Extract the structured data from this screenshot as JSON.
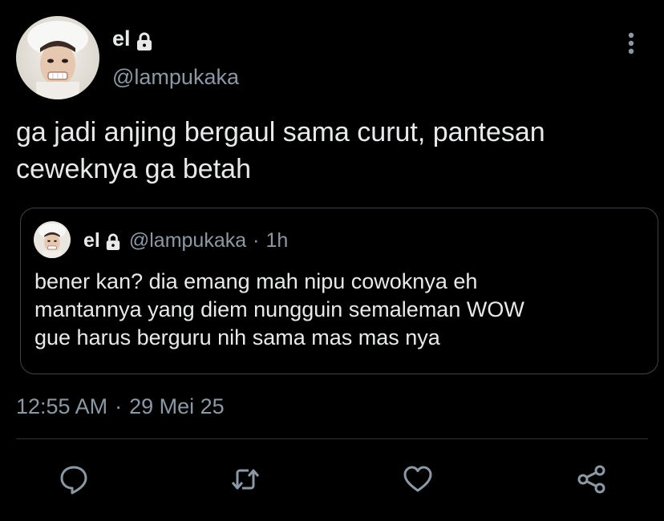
{
  "header": {
    "display_name": "el",
    "handle": "@lampukaka",
    "avatar_icon": "avatar-face",
    "lock_icon": "lock-icon",
    "more_icon": "more-vertical-icon"
  },
  "tweet": {
    "text": "ga jadi anjing bergaul sama curut, pantesan\nceweknya ga betah",
    "timestamp_time": "12:55 AM",
    "timestamp_sep": "·",
    "timestamp_date": "29 Mei 25"
  },
  "quoted_tweet": {
    "display_name": "el",
    "handle": "@lampukaka",
    "separator": "·",
    "time": "1h",
    "text": "bener kan? dia emang mah nipu cowoknya eh\nmantannya yang diem nungguin semaleman WOW\ngue harus berguru nih sama mas mas nya"
  },
  "actions": [
    {
      "icon": "reply-icon"
    },
    {
      "icon": "retweet-icon"
    },
    {
      "icon": "like-icon"
    },
    {
      "icon": "share-icon"
    }
  ],
  "colors": {
    "background": "#000000",
    "text": "#e7e9ea",
    "secondary": "#8b98a5",
    "border": "#3e4349",
    "divider": "#2f3336"
  }
}
